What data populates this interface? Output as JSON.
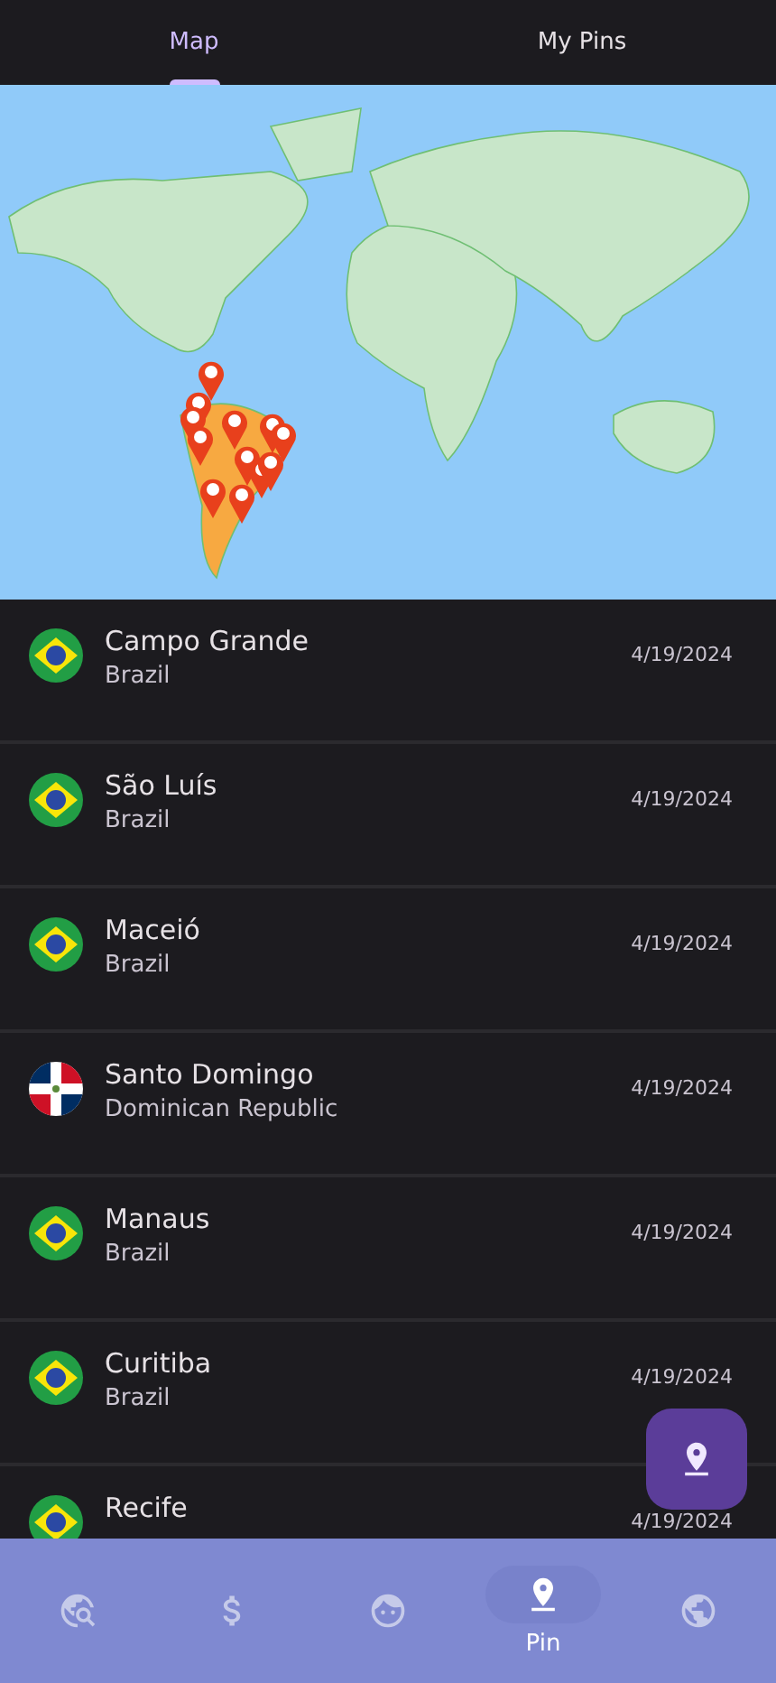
{
  "tabs": [
    {
      "label": "Map",
      "selected": true
    },
    {
      "label": "My Pins",
      "selected": false
    }
  ],
  "pins": [
    {
      "city": "Campo Grande",
      "country": "Brazil",
      "date": "4/19/2024",
      "kind": "brazil"
    },
    {
      "city": "São Luís",
      "country": "Brazil",
      "date": "4/19/2024",
      "kind": "brazil"
    },
    {
      "city": "Maceió",
      "country": "Brazil",
      "date": "4/19/2024",
      "kind": "brazil"
    },
    {
      "city": "Santo Domingo",
      "country": "Dominican Republic",
      "date": "4/19/2024",
      "kind": "dominican_republic"
    },
    {
      "city": "Manaus",
      "country": "Brazil",
      "date": "4/19/2024",
      "kind": "brazil"
    },
    {
      "city": "Curitiba",
      "country": "Brazil",
      "date": "4/19/2024",
      "kind": "brazil"
    },
    {
      "city": "Recife",
      "date": "4/19/2024",
      "kind": "brazil"
    }
  ],
  "nav": [
    {
      "kind": "explore",
      "selected": false
    },
    {
      "kind": "money",
      "selected": false
    },
    {
      "kind": "face",
      "selected": false
    },
    {
      "kind": "pin",
      "label": "Pin",
      "selected": true
    },
    {
      "kind": "globe",
      "selected": false
    }
  ]
}
